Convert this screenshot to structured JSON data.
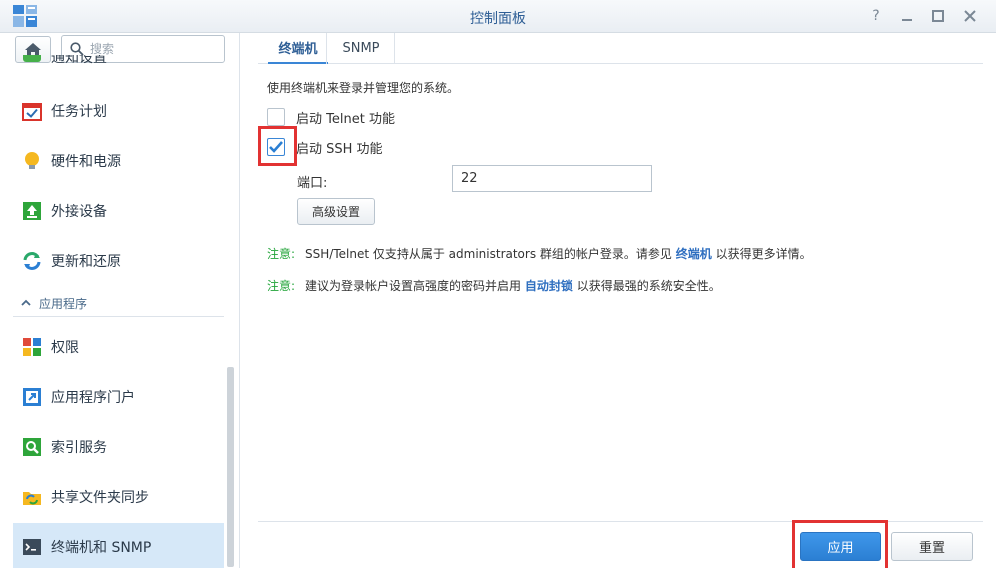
{
  "window": {
    "title": "控制面板",
    "controls": {
      "help": "?",
      "minimize": "—",
      "maximize": "□",
      "close": "✕"
    }
  },
  "sidebar": {
    "search_placeholder": "搜索",
    "partial_item": "通知设置",
    "items": [
      {
        "label": "任务计划",
        "icon": "task-scheduler-icon"
      },
      {
        "label": "硬件和电源",
        "icon": "lightbulb-icon"
      },
      {
        "label": "外接设备",
        "icon": "external-device-icon"
      },
      {
        "label": "更新和还原",
        "icon": "update-restore-icon"
      }
    ],
    "section": "应用程序",
    "app_items": [
      {
        "label": "权限",
        "icon": "privileges-icon"
      },
      {
        "label": "应用程序门户",
        "icon": "app-portal-icon"
      },
      {
        "label": "索引服务",
        "icon": "indexing-service-icon"
      },
      {
        "label": "共享文件夹同步",
        "icon": "shared-folder-sync-icon"
      },
      {
        "label": "终端机和 SNMP",
        "icon": "terminal-icon",
        "active": true
      }
    ]
  },
  "tabs": [
    {
      "label": "终端机",
      "active": true
    },
    {
      "label": "SNMP",
      "active": false
    }
  ],
  "main": {
    "description": "使用终端机来登录并管理您的系统。",
    "telnet": {
      "label": "启动 Telnet 功能",
      "checked": false
    },
    "ssh": {
      "label": "启动 SSH 功能",
      "checked": true
    },
    "port_label": "端口:",
    "port_value": "22",
    "advanced_button": "高级设置",
    "note1": {
      "tag": "注意:",
      "text_before": "SSH/Telnet 仅支持从属于 administrators 群组的帐户登录。请参见",
      "link": "终端机",
      "text_after": "以获得更多详情。"
    },
    "note2": {
      "tag": "注意:",
      "text_before": "建议为登录帐户设置高强度的密码并启用",
      "link": "自动封锁",
      "text_after": "以获得最强的系统安全性。"
    }
  },
  "footer": {
    "apply": "应用",
    "reset": "重置"
  },
  "colors": {
    "accent": "#2b7fd3",
    "active_item_bg": "#d6e8f8",
    "note_tag": "#23a43a",
    "link": "#2f6fc0",
    "highlight": "#e23232"
  }
}
